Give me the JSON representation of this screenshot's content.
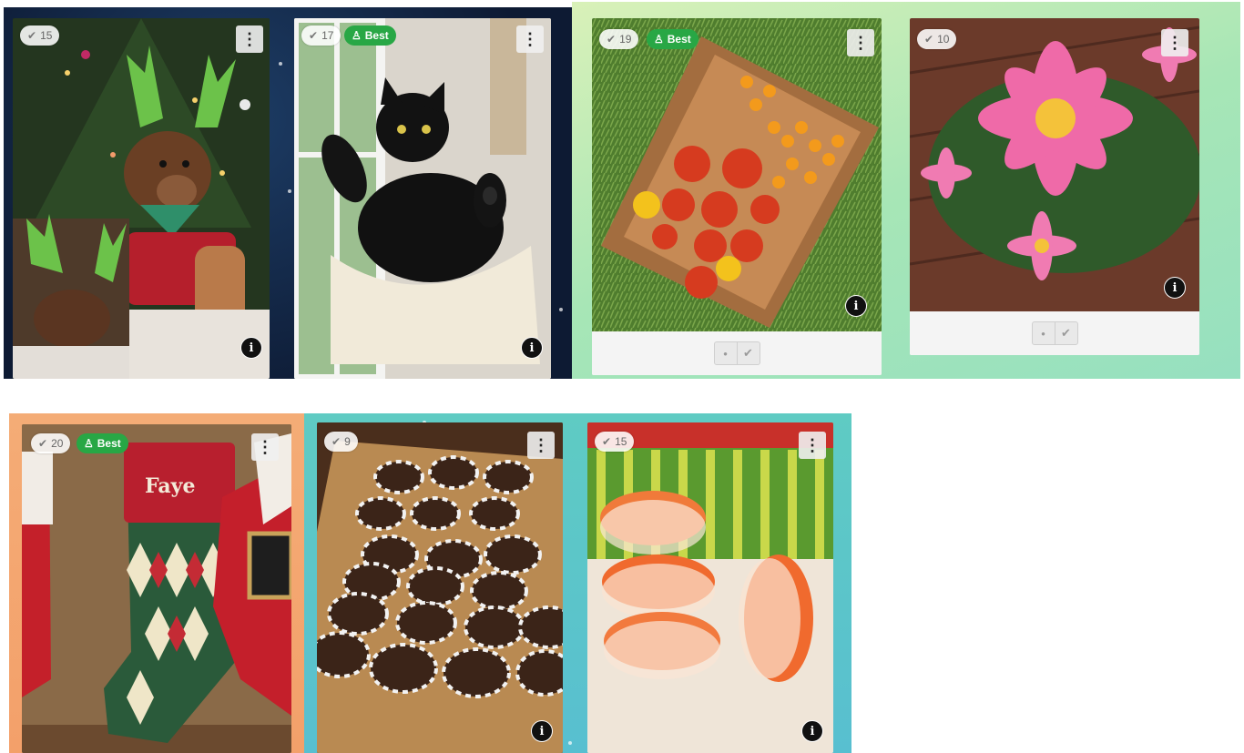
{
  "cards": [
    {
      "id": "dog",
      "votes": "15",
      "best": false
    },
    {
      "id": "cat",
      "votes": "17",
      "best": true
    },
    {
      "id": "tomatoes",
      "votes": "19",
      "best": true
    },
    {
      "id": "dahlia",
      "votes": "10",
      "best": false
    },
    {
      "id": "stockings",
      "votes": "20",
      "best": true
    },
    {
      "id": "cookies",
      "votes": "9",
      "best": false
    },
    {
      "id": "macarons",
      "votes": "15",
      "best": false
    }
  ],
  "labels": {
    "best": "Best",
    "menu_glyph": "⋮",
    "info_glyph": "i",
    "check_glyph": "✔",
    "vote_dot": "•",
    "stocking_name": "Faye"
  },
  "colors": {
    "best_badge": "#28a745",
    "panel_night": "#0f1f3a",
    "panel_mint": "#aee6b3",
    "panel_peach": "#f3a777",
    "panel_teal": "#5fc8c4"
  },
  "icons": [
    "check-icon",
    "trophy-icon",
    "kebab-menu-icon",
    "info-icon"
  ]
}
